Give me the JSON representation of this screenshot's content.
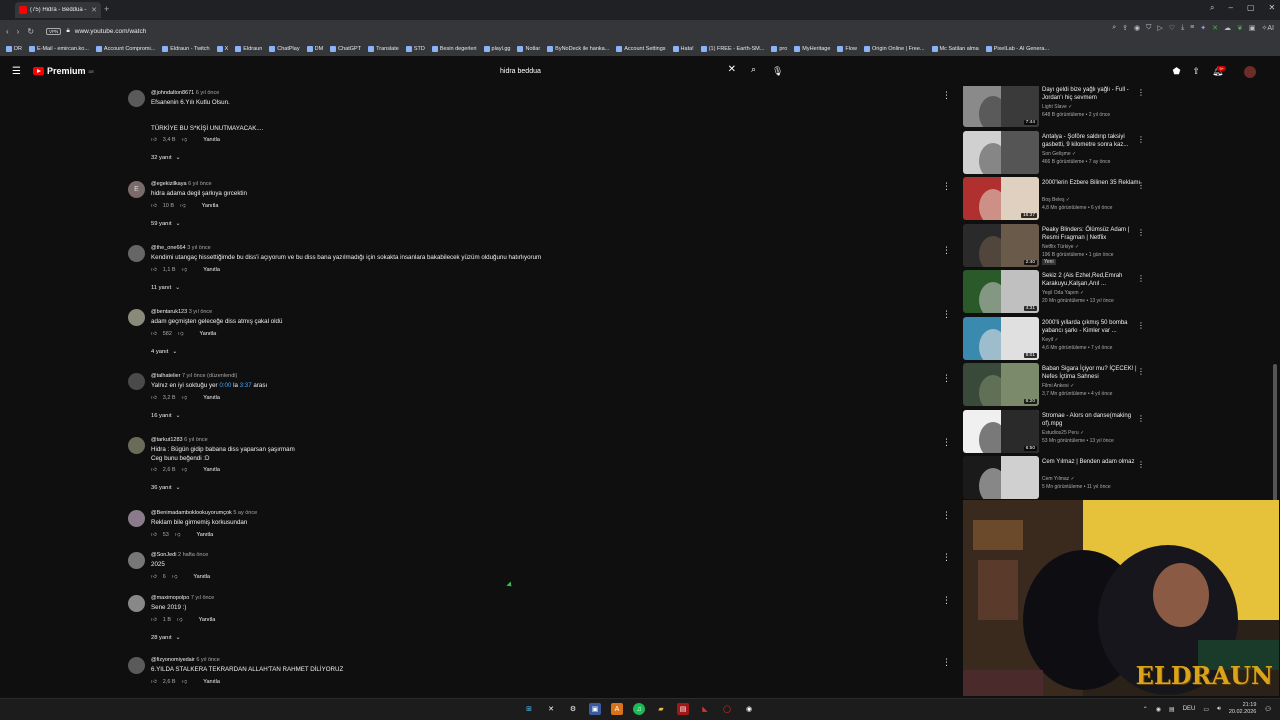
{
  "browser": {
    "tab_title": "(75) Hidra - Beddua -",
    "url": "www.youtube.com/watch",
    "vpn_label": "VPN",
    "bookmarks": [
      "DR",
      "E-Mail - emircan.ko...",
      "Account Compromi...",
      "Eldraun - Twitch",
      "X",
      "Eldraun",
      "ChatPlay",
      "DM",
      "ChatGPT",
      "Translate",
      "STD",
      "Besin degerleri",
      "playl.gg",
      "Notlar",
      "ByNoDeck ile hanka...",
      "Account Settings",
      "Hata!",
      "(1) FREE - Earth-SM...",
      "pro",
      "MyHeritage",
      "Flow",
      "Origin Online | Free...",
      "Mc Satilan alma",
      "PixelLab - AI Genera..."
    ]
  },
  "youtube": {
    "brand": "Premium",
    "region": "DE",
    "search_query": "hidra beddua",
    "notif_count": "9+"
  },
  "comments": [
    {
      "user": "@johndalton8671",
      "date": "6 yıl önce",
      "text": "Efsanenin 6.Yılı Kutlu Olsun.\n\n\nTÜRKİYE BU S*KİŞİ UNUTMAYACAK....",
      "likes": "3,4 B",
      "reply": "Yanıtla",
      "replies": "32 yanıt",
      "avatar": "#5a5a5a",
      "letter": ""
    },
    {
      "user": "@egekizilkaya",
      "date": "6 yıl önce",
      "text": "hidra adama degil şarkıya gırcektin",
      "likes": "10 B",
      "reply": "Yanıtla",
      "replies": "59 yanıt",
      "avatar": "#7a6a6a",
      "letter": "E"
    },
    {
      "user": "@the_one664",
      "date": "3 yıl önce",
      "text": "Kendimi utangaç hissettiğimde bu diss'i açıyorum ve bu diss bana yazılmadığı için sokakta insanlara bakabilecek yüzüm olduğunu hatırlıyorum",
      "likes": "1,1 B",
      "reply": "Yanıtla",
      "replies": "11 yanıt",
      "avatar": "#666",
      "letter": ""
    },
    {
      "user": "@bentaruk123",
      "date": "3 yıl önce",
      "text": "adam geçmişten geleceğe diss atmış çakal oldü",
      "likes": "582",
      "reply": "Yanıtla",
      "replies": "4 yanıt",
      "avatar": "#8a8a7a",
      "letter": ""
    },
    {
      "user": "@talhatelier",
      "date": "7 yıl önce (düzenlendi)",
      "text": "Yalnız en iyi soktuğu yer 0:00 la 3:37 arası",
      "likes": "3,2 B",
      "reply": "Yanıtla",
      "replies": "16 yanıt",
      "avatar": "#4a4a4a",
      "letter": ""
    },
    {
      "user": "@tarkut1283",
      "date": "6 yıl önce",
      "text": "Hidra : Bügün gidip babana diss yaparsan şaşırmam\nCeg bunu beğendi :D",
      "likes": "2,6 B",
      "reply": "Yanıtla",
      "replies": "36 yanıt",
      "avatar": "#6b6b5a",
      "letter": ""
    },
    {
      "user": "@Benimadamboklookuyorumçok",
      "date": "5 ay önce",
      "text": "Reklam bile girmemiş korkusundan",
      "likes": "53",
      "reply": "Yanıtla",
      "replies": "",
      "avatar": "#8a7b8a",
      "letter": ""
    },
    {
      "user": "@SonJedi",
      "date": "2 hafta önce",
      "text": "2025",
      "likes": "6",
      "reply": "Yanıtla",
      "replies": "",
      "avatar": "#777",
      "letter": ""
    },
    {
      "user": "@maximopolpo",
      "date": "7 yıl önce",
      "text": "Sene 2019 :)",
      "likes": "1 B",
      "reply": "Yanıtla",
      "replies": "28 yanıt",
      "avatar": "#888",
      "letter": ""
    },
    {
      "user": "@fizyonomiyedair",
      "date": "6 yıl önce",
      "text": "6.YILDA STALKERA TEKRARDAN ALLAH'TAN RAHMET DİLİYORUZ",
      "likes": "2,6 B",
      "reply": "Yanıtla",
      "replies": "",
      "avatar": "#5a5a5a",
      "letter": ""
    }
  ],
  "sidebar": [
    {
      "title": "Dayı geldi bize yağlı yağlı - Full - Jordan'ı hiç sevmem",
      "channel": "Light Slave",
      "meta": "648 B görüntüleme • 2 yıl önce",
      "duration": "7:44",
      "c1": "#8a8a8a",
      "c2": "#3a3a3a"
    },
    {
      "title": "Antalya - Şoföre saldırıp taksiyi gasbetti, 9 kilometre sonra kaz...",
      "channel": "Son Gelişme",
      "meta": "466 B görüntüleme • 7 ay önce",
      "duration": "",
      "c1": "#d0d0d0",
      "c2": "#555"
    },
    {
      "title": "2000'lerin Ezbere Bilinen 35 Reklamı",
      "channel": "Boş Beleş",
      "meta": "4,8 Mn görüntüleme • 6 yıl önce",
      "duration": "16:37",
      "c1": "#b03030",
      "c2": "#e0d0c0"
    },
    {
      "title": "Peaky Blinders: Ölümsüz Adam | Resmi Fragman | Netflix",
      "channel": "Netflix Türkiye",
      "meta": "196 B görüntüleme • 1 gün önce",
      "duration": "2:40",
      "c1": "#2a2a2a",
      "c2": "#6a5a4a",
      "badge": "Yeni"
    },
    {
      "title": "Sekiz 2 (Ais Ezhel,Red,Emrah Karakuyu,Kalşan,Anıl ...",
      "channel": "Yeşil Oda Yapım",
      "meta": "20 Mn görüntüleme • 13 yıl önce",
      "duration": "4:31",
      "c1": "#2a5a2a",
      "c2": "#c0c0c0"
    },
    {
      "title": "2000'li yıllarda çıkmış 50 bomba yabancı şarkı - Kimler var ...",
      "channel": "Keyif",
      "meta": "4,6 Mn görüntüleme • 7 yıl önce",
      "duration": "8:01",
      "c1": "#3a8ab0",
      "c2": "#e0e0e0"
    },
    {
      "title": "Baban Sigara İçiyor mu? İÇECEK! | Nefes İçtima Sahnesi",
      "channel": "Filmi Ankesi",
      "meta": "3,7 Mn görüntüleme • 4 yıl önce",
      "duration": "6:20",
      "c1": "#3a4a3a",
      "c2": "#7a8a6a"
    },
    {
      "title": "Stromae - Alors on danse(making of).mpg",
      "channel": "Estudios25 Peru",
      "meta": "53 Mn görüntüleme • 13 yıl önce",
      "duration": "6:50",
      "c1": "#f0f0f0",
      "c2": "#2a2a2a"
    },
    {
      "title": "Cem Yılmaz | Benden adam olmaz",
      "channel": "Cem Yılmaz",
      "meta": "5 Mn görüntüleme • 11 yıl önce",
      "duration": "",
      "c1": "#1a1a1a",
      "c2": "#d0d0d0"
    }
  ],
  "webcam": {
    "logo": "ELDRAUN"
  },
  "taskbar": {
    "lang": "DEU",
    "time": "21:19",
    "date": "20.02.2026"
  }
}
